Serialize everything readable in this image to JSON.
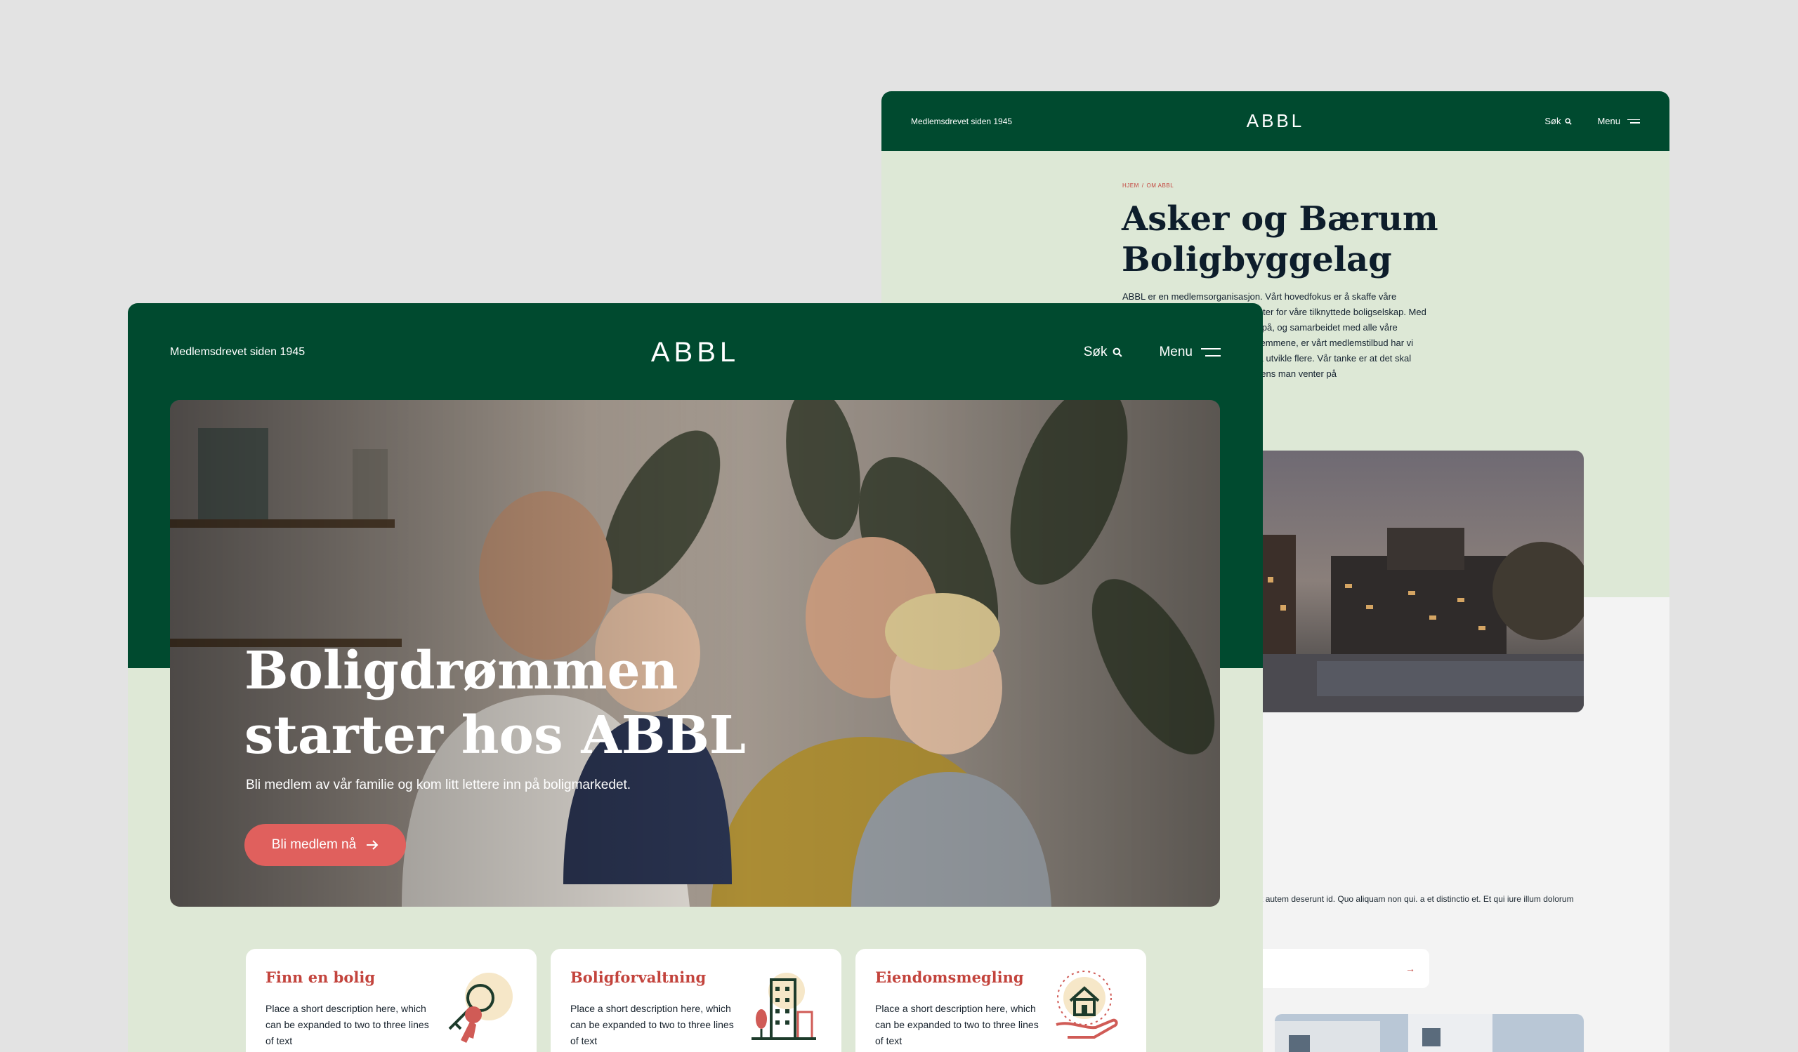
{
  "back_window": {
    "header": {
      "tagline": "Medlemsdrevet siden 1945",
      "logo": "ABBL",
      "search_label": "Søk",
      "menu_label": "Menu"
    },
    "breadcrumb": {
      "home": "HJEM",
      "separator": "/",
      "current": "OM ABBL"
    },
    "title_line1": "Asker og Bærum",
    "title_line2": "Boligbyggelag",
    "intro": "ABBL er en medlemsorganisasjon. Vårt hovedfokus er å skaffe våre medlemmer gode boliger og tjenester for våre tilknyttede boligselskap. Med den brede kompetansen vi kan by på, og samarbeidet med alle våre tilknyttede boligselskap og til medlemmene, er vårt medlemstilbud har vi mange gode ideer vi ønsker med å utvikle flere. Vår tanke er at det skal lønne seg å være medlem også mens man venter på",
    "body_text": "dent autem deserunt id. Quo aliquam non qui. a et distinctio et. Et qui iure illum dolorum"
  },
  "front_window": {
    "header": {
      "tagline": "Medlemsdrevet siden 1945",
      "logo": "ABBL",
      "search_label": "Søk",
      "menu_label": "Menu"
    },
    "hero": {
      "headline_line1": "Boligdrømmen",
      "headline_line2": "starter hos ABBL",
      "subtitle": "Bli medlem av vår familie og kom litt lettere inn på boligmarkedet.",
      "cta_label": "Bli medlem nå"
    },
    "cards": [
      {
        "title": "Finn en bolig",
        "icon": "keys-icon",
        "description": "Place a short description here, which can be expanded to two to three lines of text"
      },
      {
        "title": "Boligforvaltning",
        "icon": "building-icon",
        "description": "Place a short description here, which can be expanded to two to three lines of text"
      },
      {
        "title": "Eiendomsmegling",
        "icon": "house-in-hand-icon",
        "description": "Place a short description here, which can be expanded to two to three lines of text"
      }
    ]
  },
  "colors": {
    "brand_green": "#004a2f",
    "mint": "#dee8d6",
    "accent_red": "#c3443d",
    "cta": "#e0605d",
    "background": "#e3e3e3"
  }
}
